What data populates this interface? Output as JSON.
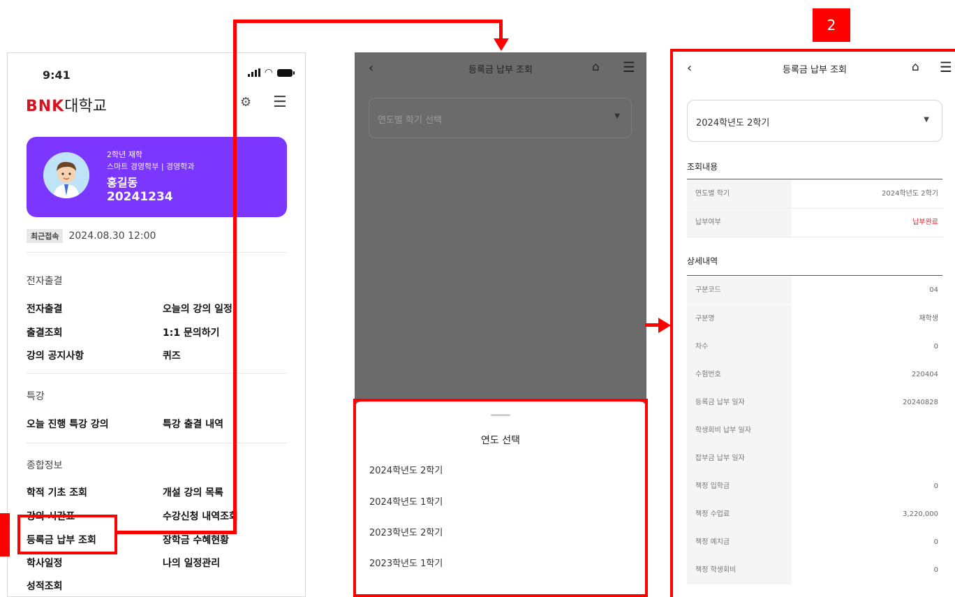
{
  "phone1": {
    "status_time": "9:41",
    "logo_bnk": "BNK",
    "logo_uni": "대학교",
    "profile": {
      "grade": "2학년 재학",
      "dept": "스마트 경영학부 | 경영학과",
      "name": "홍길동",
      "student_id": "20241234"
    },
    "recent_badge": "최근접속",
    "recent_time": "2024.08.30 12:00",
    "sections": {
      "attendance": "전자출결",
      "special": "특강",
      "general": "종합정보"
    },
    "items": {
      "e_attendance": "전자출결",
      "today_lecture": "오늘의 강의 일정",
      "attendance_check": "출결조회",
      "inquiry": "1:1 문의하기",
      "lecture_notice": "강의 공지사항",
      "quiz": "퀴즈",
      "today_special": "오늘 진행 특강 강의",
      "special_attendance": "특강 출결 내역",
      "academic_basic": "학적 기초 조회",
      "open_courses": "개설 강의 목록",
      "timetable": "강의 시간표",
      "registration_history": "수강신청 내역조회",
      "tuition": "등록금 납부 조회",
      "scholarship": "장학금 수혜현황",
      "academic_calendar": "학사일정",
      "my_schedule": "나의 일정관리",
      "grades": "성적조회"
    }
  },
  "phone2": {
    "title": "등록금 납부 조회",
    "select_placeholder": "연도별 학기 선택",
    "sheet_title": "연도 선택",
    "options": [
      "2024학년도 2학기",
      "2024학년도 1학기",
      "2023학년도 2학기",
      "2023학년도 1학기"
    ]
  },
  "phone3": {
    "title": "등록금 납부 조회",
    "selected": "2024학년도 2학기",
    "summary_title": "조회내용",
    "summary": [
      {
        "label": "연도별 학기",
        "value": "2024학년도 2학기"
      },
      {
        "label": "납부여부",
        "value": "납부완료"
      }
    ],
    "detail_title": "상세내역",
    "details": [
      {
        "label": "구분코드",
        "value": "04"
      },
      {
        "label": "구분명",
        "value": "재학생"
      },
      {
        "label": "차수",
        "value": "0"
      },
      {
        "label": "수험번호",
        "value": "220404"
      },
      {
        "label": "등록금 납부 일자",
        "value": "20240828"
      },
      {
        "label": "학생회비 납부 일자",
        "value": ""
      },
      {
        "label": "잡부금 납부 일자",
        "value": ""
      },
      {
        "label": "책정 입학금",
        "value": "0"
      },
      {
        "label": "책정 수업료",
        "value": "3,220,000"
      },
      {
        "label": "책정 예치금",
        "value": "0"
      },
      {
        "label": "책정 학생회비",
        "value": "0"
      }
    ]
  },
  "annotation": {
    "step2": "2"
  },
  "colors": {
    "brand_red": "#d7131f",
    "profile_purple": "#7b37ff",
    "annotation_red": "#ff0000",
    "paid_red": "#e0343b"
  }
}
